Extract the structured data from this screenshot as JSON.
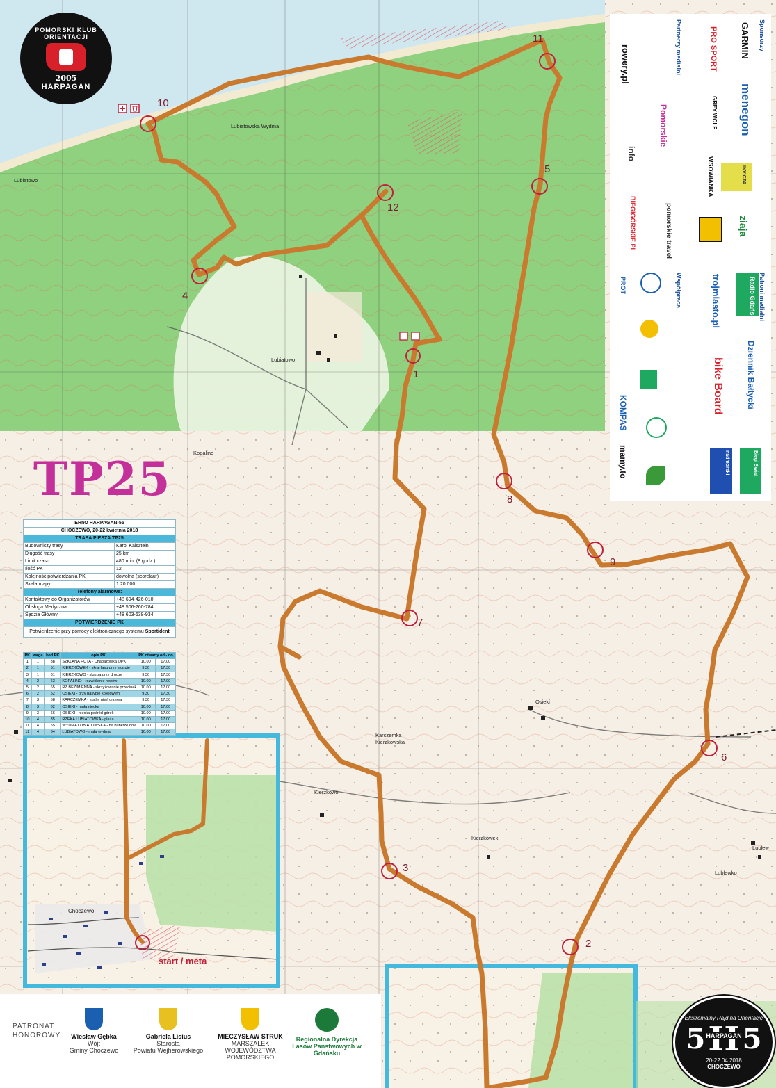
{
  "map": {
    "route_title": "TP25",
    "club_logo": {
      "top": "POMORSKI KLUB ORIENTACJI",
      "year": "2005",
      "bottom": "HARPAGAN"
    },
    "event_logo": {
      "text": "Ekstremalny Rajd na Orientację",
      "brand": "HARPAGAN",
      "left_digit": "5",
      "right_digit": "5",
      "center": "H",
      "date": "20-22.04.2018",
      "place": "CHOCZEWO"
    },
    "start_label": "start / meta",
    "place_names": [
      "Kopalino",
      "Osieki",
      "Karczemka Kierzkowska",
      "Kierzkowo",
      "Kierzkówek",
      "Lublewko",
      "Lubiatowo",
      "Lubiatowska Wydma",
      "Choczewo",
      "Lubiatowo",
      "Lublew"
    ],
    "controls": [
      "1",
      "2",
      "3",
      "4",
      "5",
      "6",
      "7",
      "8",
      "9",
      "10",
      "11",
      "12"
    ],
    "colors": {
      "route": "#c97a2e",
      "forest": "#8fd17f",
      "control": "#c0203a",
      "sea": "#cfe7ee",
      "inset_border": "#45b8dd"
    }
  },
  "info_card": {
    "event": "ERnO HARPAGAN-55",
    "date": "CHOCZEWO, 20-22 kwietnia 2018",
    "route_header": "TRASA PIESZA TP25",
    "rows": [
      {
        "label": "Budowniczy trasy",
        "value": "Karol Kalsztein"
      },
      {
        "label": "Długość trasy",
        "value": "25 km"
      },
      {
        "label": "Limit czasu",
        "value": "480 min. (8 godz.)"
      },
      {
        "label": "Ilość PK",
        "value": "12"
      },
      {
        "label": "Kolejność potwierdzania PK",
        "value": "dowolna (scorelauf)"
      },
      {
        "label": "Skala mapy",
        "value": "1:20 000"
      }
    ],
    "phones_header": "Telefony alarmowe:",
    "phones": [
      {
        "label": "Kontaktowy do Organizatorów",
        "value": "+48 694-426-010"
      },
      {
        "label": "Obsługa Medyczna",
        "value": "+48 506-260-784"
      },
      {
        "label": "Sędzia Główny",
        "value": "+48 603-638-934"
      }
    ],
    "confirm_header": "POTWIERDZENIE PK",
    "confirm_text": "Potwierdzenie przy pomocy elektronicznego systemu",
    "confirm_system": "Sportident"
  },
  "pk_table": {
    "headers": [
      "PK",
      "waga",
      "kod PK",
      "opis PK",
      "PK otwarty od - do"
    ],
    "rows": [
      [
        "1",
        "1",
        "38",
        "SZKLANA HUTA - Chabazówka OPK",
        "10.00",
        "17.00"
      ],
      [
        "2",
        "1",
        "51",
        "KIERZKÓWEK - skraj lasu przy skarpie",
        "9.30",
        "17.30"
      ],
      [
        "3",
        "1",
        "61",
        "KIERZKOWO - skarpa przy drodze",
        "9.30",
        "17.30"
      ],
      [
        "4",
        "2",
        "63",
        "KOPALINO - rozwidlenie rowów",
        "10.00",
        "17.00"
      ],
      [
        "5",
        "2",
        "65",
        "RZ BEZIMIENNA - skrzyżowanie przecinek",
        "10.00",
        "17.00"
      ],
      [
        "6",
        "2",
        "52",
        "OSIEKI - przy nasypie kolejowym",
        "9.30",
        "17.30"
      ],
      [
        "7",
        "3",
        "58",
        "KARCZEMKA - suchy pień drzewa",
        "9.30",
        "17.30"
      ],
      [
        "8",
        "3",
        "62",
        "OSIEKI - mała niecka",
        "10.00",
        "17.00"
      ],
      [
        "9",
        "3",
        "66",
        "OSIEKI - niecka pośród górek",
        "10.00",
        "17.00"
      ],
      [
        "10",
        "4",
        "35",
        "RZEKA LUBIATÓWKA - plaża",
        "10.00",
        "17.00"
      ],
      [
        "11",
        "4",
        "55",
        "WYDMA LUBIATOWSKA - na bunkrze dowodzenia",
        "10.00",
        "17.00"
      ],
      [
        "12",
        "4",
        "64",
        "LUBIATOWO - mała wydma",
        "10.00",
        "17.00"
      ]
    ]
  },
  "sponsors": {
    "sections": [
      "Sponsorzy",
      "Partnerzy medialni",
      "Patroni medialni",
      "Współpraca"
    ],
    "logos": [
      "GARMIN",
      "PRO SPORT",
      "menegon",
      "GREY WOLF",
      "INVICTA",
      "WSOWIANKA",
      "ziaja",
      "rowery.pl",
      "Pomorskie",
      "info",
      "pomorskie travel",
      "BIEGIGÓRSKIE.PL",
      "Radio Gdańsk",
      "trojmiasto.pl",
      "Dziennik Bałtycki",
      "bike Board",
      "nadmorski",
      "Biegi Świat",
      "PROT",
      "KOMPAS",
      "mamy.to"
    ]
  },
  "patronat": {
    "header": "PATRONAT HONOROWY",
    "items": [
      {
        "name": "Wiesław Gębka",
        "title1": "Wójt",
        "title2": "Gminy Choczewo"
      },
      {
        "name": "Gabriela Lisius",
        "title1": "Starosta",
        "title2": "Powiatu Wejherowskiego"
      },
      {
        "name": "MIECZYSŁAW STRUK",
        "title1": "MARSZAŁEK",
        "title2": "WOJEWÓDZTWA POMORSKIEGO"
      },
      {
        "name": "Regionalna Dyrekcja",
        "title1": "Lasów Państwowych w Gdańsku",
        "title2": ""
      }
    ]
  }
}
